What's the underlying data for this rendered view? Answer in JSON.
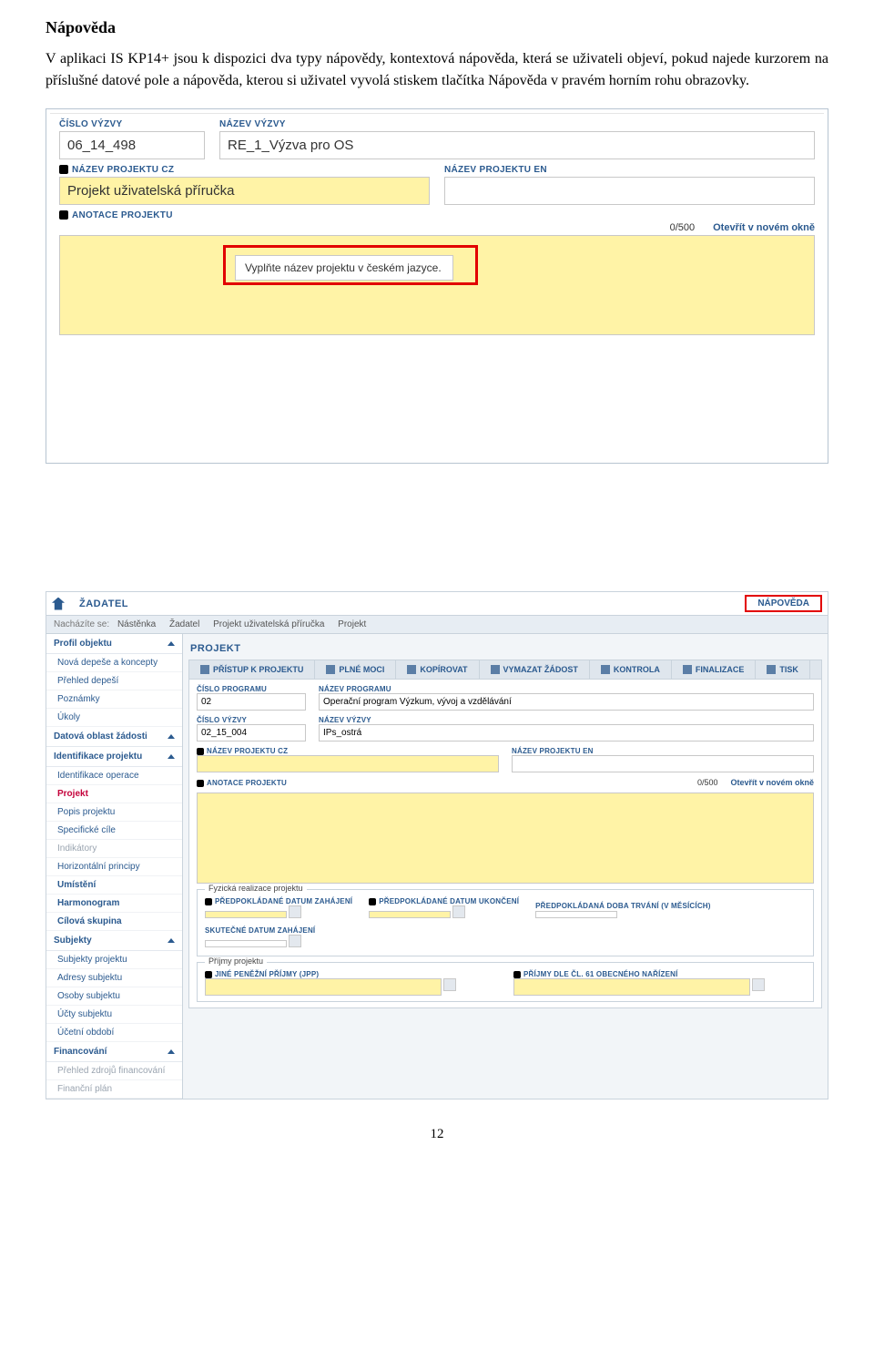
{
  "doc": {
    "heading": "Nápověda",
    "paragraph": "V aplikaci IS KP14+ jsou k dispozici dva typy nápovědy, kontextová nápověda, která se uživateli objeví, pokud najede kurzorem na příslušné datové pole a nápověda, kterou si uživatel vyvolá stiskem tlačítka Nápověda v pravém horním rohu obrazovky.",
    "page_number": "12"
  },
  "shot1": {
    "lbl_cislo_vyzvy": "ČÍSLO VÝZVY",
    "val_cislo_vyzvy": "06_14_498",
    "lbl_nazev_vyzvy": "NÁZEV VÝZVY",
    "val_nazev_vyzvy": "RE_1_Výzva pro OS",
    "lbl_nazev_proj_cz": "NÁZEV PROJEKTU CZ",
    "val_nazev_proj_cz": "Projekt uživatelská příručka",
    "lbl_nazev_proj_en": "NÁZEV PROJEKTU EN",
    "lbl_anotace": "ANOTACE PROJEKTU",
    "tooltip": "Vyplňte název projektu v českém jazyce.",
    "counter": "0/500",
    "open_new": "Otevřít v novém okně"
  },
  "shot2": {
    "tab": "ŽADATEL",
    "napoveda": "NÁPOVĚDA",
    "bc_label": "Nacházíte se:",
    "bc": [
      "Nástěnka",
      "Žadatel",
      "Projekt uživatelská příručka",
      "Projekt"
    ],
    "side": {
      "sec_profil": "Profil objektu",
      "items_profil": [
        "Nová depeše a koncepty",
        "Přehled depeší",
        "Poznámky",
        "Úkoly"
      ],
      "sec_datova": "Datová oblast žádosti",
      "sec_ident": "Identifikace projektu",
      "items_ident": [
        "Identifikace operace",
        "Projekt",
        "Popis projektu",
        "Specifické cíle",
        "Indikátory",
        "Horizontální principy"
      ],
      "item_umisteni": "Umístění",
      "item_harmonogram": "Harmonogram",
      "item_cilova": "Cílová skupina",
      "sec_subjekty": "Subjekty",
      "items_subjekty": [
        "Subjekty projektu",
        "Adresy subjektu",
        "Osoby subjektu",
        "Účty subjektu",
        "Účetní období"
      ],
      "sec_financ": "Financování",
      "items_financ": [
        "Přehled zdrojů financování",
        "Finanční plán"
      ]
    },
    "main": {
      "title": "PROJEKT",
      "tools": [
        "PŘÍSTUP K PROJEKTU",
        "PLNÉ MOCI",
        "KOPÍROVAT",
        "VYMAZAT ŽÁDOST",
        "KONTROLA",
        "FINALIZACE",
        "TISK"
      ],
      "lbl_cislo_prog": "ČÍSLO PROGRAMU",
      "val_cislo_prog": "02",
      "lbl_nazev_prog": "NÁZEV PROGRAMU",
      "val_nazev_prog": "Operační program Výzkum, vývoj a vzdělávání",
      "lbl_cislo_vyzvy": "ČÍSLO VÝZVY",
      "val_cislo_vyzvy": "02_15_004",
      "lbl_nazev_vyzvy": "NÁZEV VÝZVY",
      "val_nazev_vyzvy": "IPs_ostrá",
      "lbl_nazev_proj_cz": "NÁZEV PROJEKTU CZ",
      "lbl_nazev_proj_en": "NÁZEV PROJEKTU EN",
      "lbl_anotace": "ANOTACE PROJEKTU",
      "counter": "0/500",
      "open_new": "Otevřít v novém okně",
      "fs_fyzicka": "Fyzická realizace projektu",
      "lbl_zahajeni": "PŘEDPOKLÁDANÉ DATUM ZAHÁJENÍ",
      "lbl_ukonceni": "PŘEDPOKLÁDANÉ DATUM UKONČENÍ",
      "lbl_trvani": "PŘEDPOKLÁDANÁ DOBA TRVÁNÍ (V MĚSÍCÍCH)",
      "lbl_skutecne": "SKUTEČNÉ DATUM ZAHÁJENÍ",
      "fs_prijmy": "Příjmy projektu",
      "lbl_jine": "JINÉ PENĚŽNÍ PŘÍJMY (JPP)",
      "lbl_prijmy61": "PŘÍJMY DLE ČL. 61 OBECNÉHO NAŘÍZENÍ"
    }
  }
}
